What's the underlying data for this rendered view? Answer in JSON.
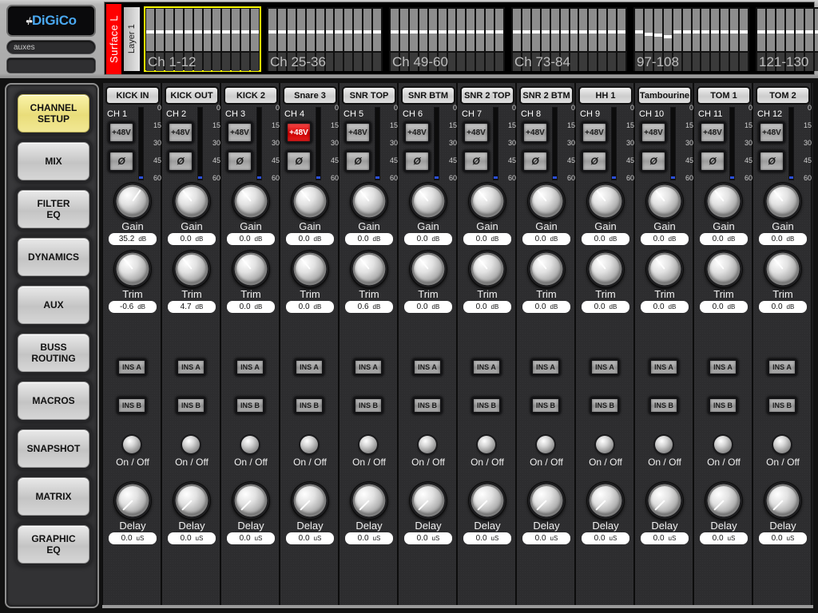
{
  "brand": {
    "logo_text": "DiGiCo",
    "logo_mark": "•/•"
  },
  "session": {
    "aux_field_value": "auxes",
    "blank_field_value": ""
  },
  "navbar": {
    "surface_label": "Surface L",
    "layer_label": "Layer 1",
    "banks": [
      {
        "label": "Ch 1-12",
        "selected": true,
        "faders": [
          50,
          50,
          50,
          50,
          50,
          50,
          50,
          50,
          50,
          50,
          50,
          50
        ],
        "offset": 0
      },
      {
        "label": "Ch 25-36",
        "selected": false,
        "faders": [
          50,
          50,
          50,
          50,
          50,
          50,
          50,
          50,
          50,
          50,
          50,
          50
        ],
        "offset": 0
      },
      {
        "label": "Ch 49-60",
        "selected": false,
        "faders": [
          50,
          50,
          50,
          50,
          50,
          50,
          50,
          50,
          50,
          50,
          50,
          50
        ],
        "offset": 0
      },
      {
        "label": "Ch 73-84",
        "selected": false,
        "faders": [
          50,
          50,
          50,
          50,
          50,
          50,
          50,
          50,
          50,
          50,
          50,
          50
        ],
        "offset": 0
      },
      {
        "label": "97-108",
        "selected": false,
        "faders": [
          50,
          56,
          58,
          62,
          50,
          50,
          50,
          50,
          50,
          50,
          50,
          50
        ],
        "offset": 0
      },
      {
        "label": "121-130",
        "selected": false,
        "faders": [
          50,
          50,
          50,
          50,
          50,
          50,
          50,
          50,
          50,
          50,
          50,
          50
        ],
        "offset": 0
      }
    ]
  },
  "sidebar": {
    "items": [
      {
        "label": "CHANNEL SETUP",
        "active": true
      },
      {
        "label": "MIX",
        "active": false
      },
      {
        "label": "FILTER EQ",
        "active": false
      },
      {
        "label": "DYNAMICS",
        "active": false
      },
      {
        "label": "AUX",
        "active": false
      },
      {
        "label": "BUSS ROUTING",
        "active": false
      },
      {
        "label": "MACROS",
        "active": false
      },
      {
        "label": "SNAPSHOT",
        "active": false
      },
      {
        "label": "MATRIX",
        "active": false
      },
      {
        "label": "GRAPHIC EQ",
        "active": false
      }
    ]
  },
  "strip_common": {
    "phantom_label": "+48V",
    "phase_label": "Ø",
    "ins_a_label": "INS A",
    "ins_b_label": "INS B",
    "onoff_label": "On / Off",
    "gain_label": "Gain",
    "trim_label": "Trim",
    "delay_label": "Delay",
    "db_unit": "dB",
    "us_unit": "uS",
    "meter_scale": [
      "0",
      "15",
      "30",
      "45",
      "60"
    ]
  },
  "channels": [
    {
      "name": "KICK IN",
      "ch": "CH 1",
      "phantom": false,
      "phase": false,
      "gain": "35.2",
      "gain_angle": 35,
      "trim": "-0.6",
      "trim_angle": -40,
      "delay": "0.0",
      "delay_angle": -135,
      "ins_a": false,
      "ins_b": false,
      "on": false,
      "meter": 3
    },
    {
      "name": "KICK OUT",
      "ch": "CH 2",
      "phantom": false,
      "phase": false,
      "gain": "0.0",
      "gain_angle": -40,
      "trim": "4.7",
      "trim_angle": -40,
      "delay": "0.0",
      "delay_angle": -135,
      "ins_a": false,
      "ins_b": false,
      "on": false,
      "meter": 3
    },
    {
      "name": "KICK 2",
      "ch": "CH 3",
      "phantom": false,
      "phase": false,
      "gain": "0.0",
      "gain_angle": -40,
      "trim": "0.0",
      "trim_angle": -40,
      "delay": "0.0",
      "delay_angle": -135,
      "ins_a": false,
      "ins_b": false,
      "on": false,
      "meter": 3
    },
    {
      "name": "Snare 3",
      "ch": "CH 4",
      "phantom": true,
      "phase": false,
      "gain": "0.0",
      "gain_angle": -40,
      "trim": "0.0",
      "trim_angle": -40,
      "delay": "0.0",
      "delay_angle": -135,
      "ins_a": false,
      "ins_b": false,
      "on": false,
      "meter": 3
    },
    {
      "name": "SNR TOP",
      "ch": "CH 5",
      "phantom": false,
      "phase": false,
      "gain": "0.0",
      "gain_angle": -40,
      "trim": "0.6",
      "trim_angle": -40,
      "delay": "0.0",
      "delay_angle": -135,
      "ins_a": false,
      "ins_b": false,
      "on": false,
      "meter": 3
    },
    {
      "name": "SNR BTM",
      "ch": "CH 6",
      "phantom": false,
      "phase": false,
      "gain": "0.0",
      "gain_angle": -40,
      "trim": "0.0",
      "trim_angle": -40,
      "delay": "0.0",
      "delay_angle": -135,
      "ins_a": false,
      "ins_b": false,
      "on": false,
      "meter": 3
    },
    {
      "name": "SNR 2 TOP",
      "ch": "CH 7",
      "phantom": false,
      "phase": false,
      "gain": "0.0",
      "gain_angle": -40,
      "trim": "0.0",
      "trim_angle": -40,
      "delay": "0.0",
      "delay_angle": -135,
      "ins_a": false,
      "ins_b": false,
      "on": false,
      "meter": 3
    },
    {
      "name": "SNR 2 BTM",
      "ch": "CH 8",
      "phantom": false,
      "phase": false,
      "gain": "0.0",
      "gain_angle": -40,
      "trim": "0.0",
      "trim_angle": -40,
      "delay": "0.0",
      "delay_angle": -135,
      "ins_a": false,
      "ins_b": false,
      "on": false,
      "meter": 3
    },
    {
      "name": "HH 1",
      "ch": "CH 9",
      "phantom": false,
      "phase": false,
      "gain": "0.0",
      "gain_angle": -40,
      "trim": "0.0",
      "trim_angle": -40,
      "delay": "0.0",
      "delay_angle": -135,
      "ins_a": false,
      "ins_b": false,
      "on": false,
      "meter": 3
    },
    {
      "name": "Tambourine",
      "ch": "CH 10",
      "phantom": false,
      "phase": false,
      "gain": "0.0",
      "gain_angle": -40,
      "trim": "0.0",
      "trim_angle": -40,
      "delay": "0.0",
      "delay_angle": -135,
      "ins_a": false,
      "ins_b": false,
      "on": false,
      "meter": 3
    },
    {
      "name": "TOM 1",
      "ch": "CH 11",
      "phantom": false,
      "phase": false,
      "gain": "0.0",
      "gain_angle": -40,
      "trim": "0.0",
      "trim_angle": -40,
      "delay": "0.0",
      "delay_angle": -135,
      "ins_a": false,
      "ins_b": false,
      "on": false,
      "meter": 3
    },
    {
      "name": "TOM 2",
      "ch": "CH 12",
      "phantom": false,
      "phase": false,
      "gain": "0.0",
      "gain_angle": -40,
      "trim": "0.0",
      "trim_angle": -40,
      "delay": "0.0",
      "delay_angle": -135,
      "ins_a": false,
      "ins_b": false,
      "on": false,
      "meter": 3
    }
  ],
  "colors": {
    "accent_yellow": "#ffff00",
    "phantom_on": "#d40000",
    "surface_red": "#ff0000",
    "meter_blue": "#2b4fd8"
  }
}
